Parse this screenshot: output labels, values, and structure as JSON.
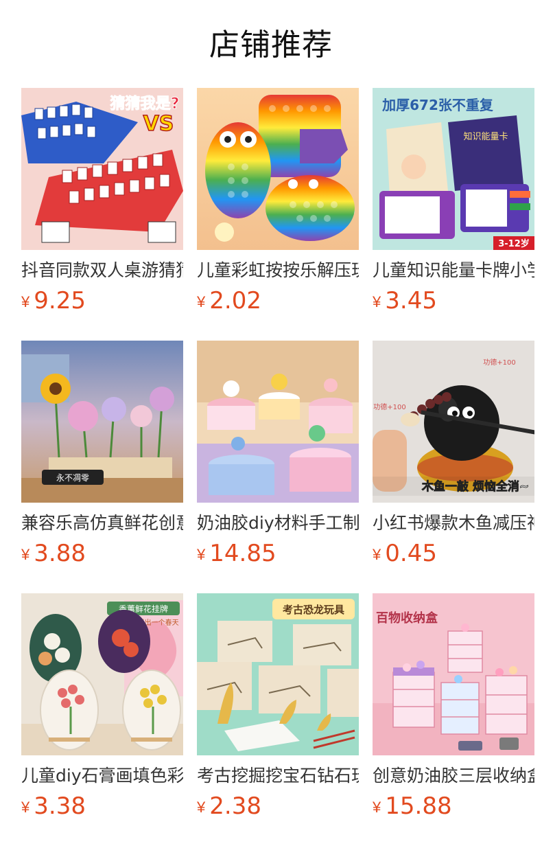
{
  "header": {
    "title": "店铺推荐"
  },
  "currency_symbol": "¥",
  "colors": {
    "price": "#e24a1f"
  },
  "products": [
    {
      "name": "抖音同款双人桌游猜猜我是谁",
      "price": "9.25",
      "image_text": [
        "猜猜我是?",
        "VS"
      ],
      "icon": "board-game-image"
    },
    {
      "name": "儿童彩虹按按乐解压玩具",
      "price": "2.02",
      "image_text": [],
      "icon": "pop-it-toys-image"
    },
    {
      "name": "儿童知识能量卡牌小学生",
      "price": "3.45",
      "image_text": [
        "加厚672张不重复",
        "知识能量卡",
        "3-12岁"
      ],
      "icon": "knowledge-cards-image"
    },
    {
      "name": "兼容乐高仿真鲜花创意积木",
      "price": "3.88",
      "image_text": [
        "永不凋零"
      ],
      "icon": "flower-blocks-image"
    },
    {
      "name": "奶油胶diy材料手工制作蛋糕",
      "price": "14.85",
      "image_text": [],
      "icon": "cream-glue-cake-image"
    },
    {
      "name": "小红书爆款木鱼减压神器",
      "price": "0.45",
      "image_text": [
        "功德+100",
        "木鱼一敲 烦恼全消~"
      ],
      "icon": "wooden-fish-image"
    },
    {
      "name": "儿童diy石膏画填色彩绘",
      "price": "3.38",
      "image_text": [
        "香薰鲜花挂牌",
        "花点时间 画出一个春天"
      ],
      "icon": "plaster-painting-image"
    },
    {
      "name": "考古挖掘挖宝石钻石玩具",
      "price": "2.38",
      "image_text": [
        "考古恐龙玩具"
      ],
      "icon": "dinosaur-dig-image"
    },
    {
      "name": "创意奶油胶三层收纳盒",
      "price": "15.88",
      "image_text": [
        "百物收纳盒"
      ],
      "icon": "storage-box-image"
    }
  ]
}
